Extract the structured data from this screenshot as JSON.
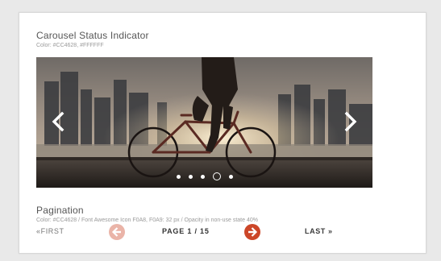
{
  "carousel_section": {
    "title": "Carousel Status Indicator",
    "subtitle": "Color: #CC4628, #FFFFFF",
    "prev_icon": "chevron-left-icon",
    "next_icon": "chevron-right-icon",
    "dots_count": 5,
    "active_dot_index": 3
  },
  "pagination_section": {
    "title": "Pagination",
    "subtitle": "Color: #CC4628 / Font Awesome Icon F0A8, F0A9: 32 px / Opacity in non-use state 40%",
    "first_label": "«FIRST",
    "page_label": "PAGE 1 / 15",
    "last_label": "LAST »",
    "prev_icon": "arrow-circle-left-icon",
    "next_icon": "arrow-circle-right-icon",
    "prev_opacity": 0.4
  },
  "colors": {
    "accent": "#CC4628",
    "white": "#FFFFFF"
  }
}
